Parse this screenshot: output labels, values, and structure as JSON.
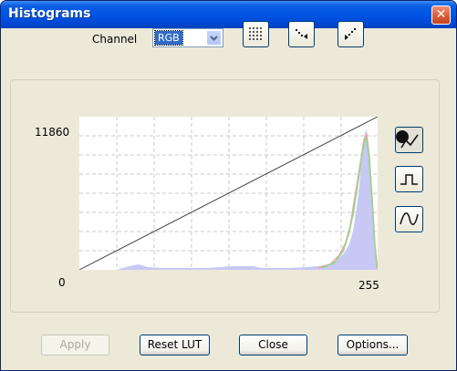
{
  "window": {
    "title": "Histograms",
    "close_label": "✕"
  },
  "toolbar": {
    "channel_label": "Channel",
    "channel_value": "RGB",
    "tools": [
      "grid-toggle-icon",
      "points-left-icon",
      "points-right-icon"
    ]
  },
  "histogram": {
    "y_max_label": "11860",
    "x_min_label": "0",
    "x_max_label": "255",
    "curve_tools": [
      "curve-points-icon",
      "step-curve-icon",
      "smooth-curve-icon"
    ],
    "colors": {
      "fill": "#c8c8f4",
      "red": "#f0a0a0",
      "green": "#90d890",
      "lut": "#404040"
    }
  },
  "buttons": {
    "apply": "Apply",
    "reset_lut": "Reset LUT",
    "close": "Close",
    "options": "Options..."
  }
}
